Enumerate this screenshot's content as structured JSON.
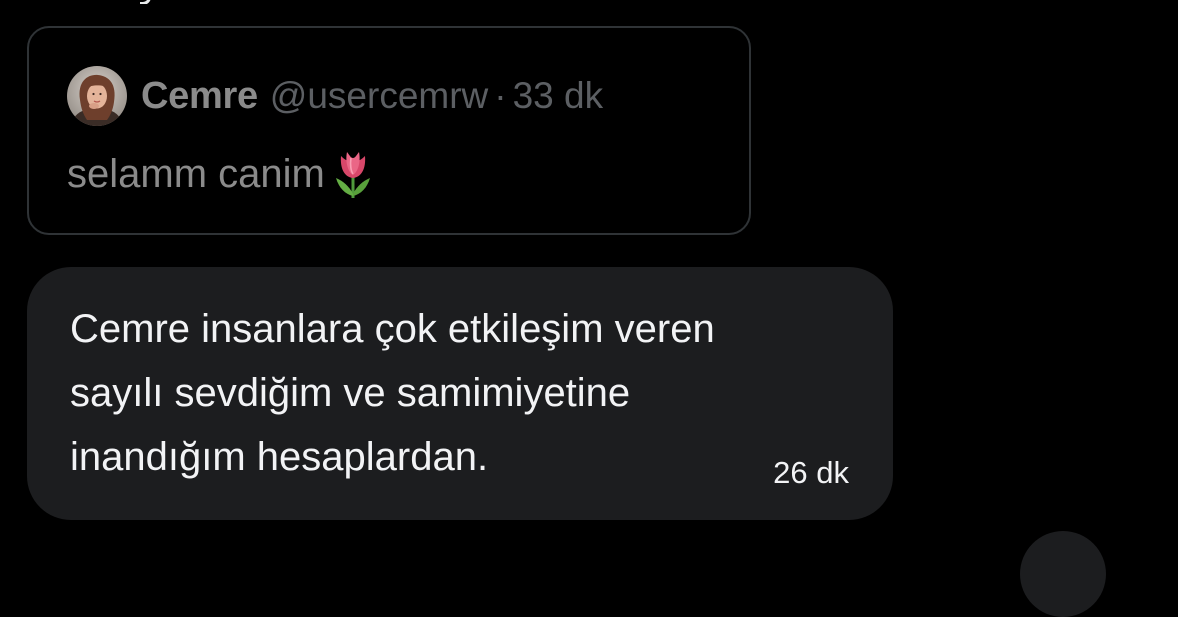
{
  "quoted_tweet": {
    "display_name": "Cemre",
    "handle": "@usercemrw",
    "separator": "·",
    "time": "33 dk",
    "text": "selamm canim",
    "emoji_icon": "tulip-icon"
  },
  "message": {
    "lines": [
      "Cemre insanlara çok etkileşim veren",
      "sayılı sevdiğim ve samimiyetine",
      "inandığım hesaplardan."
    ],
    "time": "26 dk"
  },
  "colors": {
    "background": "#000000",
    "bubble": "#1c1d1f",
    "card_border": "#2f3336",
    "muted_text": "#8b8b8b"
  }
}
